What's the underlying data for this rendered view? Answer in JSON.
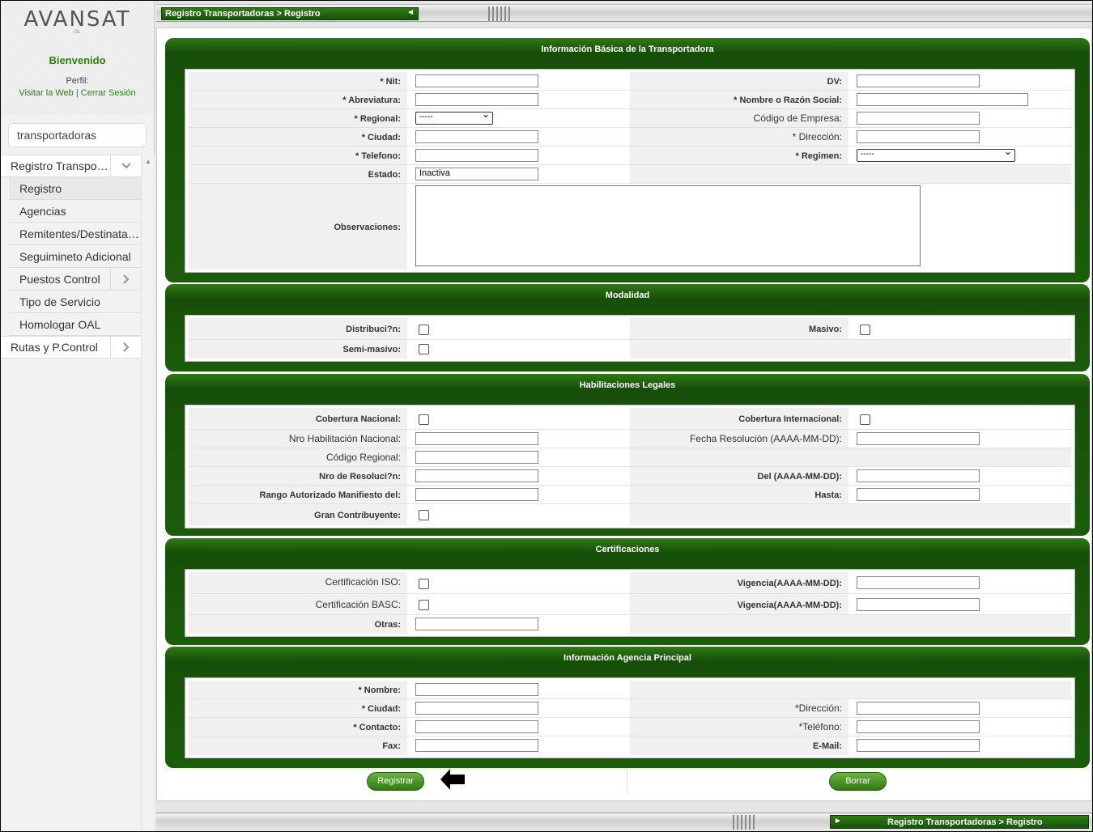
{
  "sidebar": {
    "logo_text": "AVANSAT",
    "logo_sub": "GL",
    "welcome": "Bienvenido",
    "perfil_label": "Perfil:",
    "link_web": "Visitar la Web",
    "link_sep": " | ",
    "link_logout": "Cerrar Sesión",
    "search_value": "transportadoras",
    "menu": {
      "top1": "Registro Transportadoras",
      "sub": [
        "Registro",
        "Agencias",
        "Remitentes/Destinatarios",
        "Seguimineto Adicional",
        "Puestos Control",
        "Tipo de Servicio",
        "Homologar OAL"
      ],
      "top2": "Rutas y P.Control"
    }
  },
  "breadcrumb": "Registro Transportadoras > Registro",
  "sections": {
    "basica": {
      "title": "Información Básica de la Transportadora",
      "nit": "* Nit:",
      "dv": "DV:",
      "abreviatura": "* Abreviatura:",
      "razon": "* Nombre o Razón Social:",
      "regional": "* Regional:",
      "regional_value": "-----",
      "codigo_empresa": "Código de Empresa:",
      "ciudad": "* Ciudad:",
      "direccion": "* Dirección:",
      "telefono": "* Telefono:",
      "regimen": "* Regimen:",
      "regimen_value": "-----",
      "estado": "Estado:",
      "estado_value": "Inactiva",
      "observaciones": "Observaciones:"
    },
    "modalidad": {
      "title": "Modalidad",
      "distribucion": "Distribuci?n:",
      "masivo": "Masivo:",
      "semimasivo": "Semi-masivo:"
    },
    "habilitaciones": {
      "title": "Habilitaciones Legales",
      "cobertura_nacional": "Cobertura Nacional:",
      "cobertura_internacional": "Cobertura Internacional:",
      "nro_habilitacion": "Nro Habilitación Nacional:",
      "fecha_resolucion": "Fecha Resolución (AAAA-MM-DD):",
      "codigo_regional": "Código Regional:",
      "nro_resolucion": "Nro de Resoluci?n:",
      "del": "Del (AAAA-MM-DD):",
      "rango": "Rango Autorizado Manifiesto del:",
      "hasta": "Hasta:",
      "gran_contribuyente": "Gran Contribuyente:"
    },
    "certificaciones": {
      "title": "Certificaciones",
      "iso": "Certificación ISO:",
      "vigencia1": "Vigencia(AAAA-MM-DD):",
      "basc": "Certificación BASC:",
      "vigencia2": "Vigencia(AAAA-MM-DD):",
      "otras": "Otras:"
    },
    "agencia": {
      "title": "Información Agencia Principal",
      "nombre": "*  Nombre:",
      "ciudad": "* Ciudad:",
      "direccion": "*Dirección:",
      "contacto": "* Contacto:",
      "telefono": "*Teléfono:",
      "fax": "Fax:",
      "email": "E-Mail:"
    }
  },
  "buttons": {
    "registrar": "Registrar",
    "borrar": "Borrar"
  }
}
